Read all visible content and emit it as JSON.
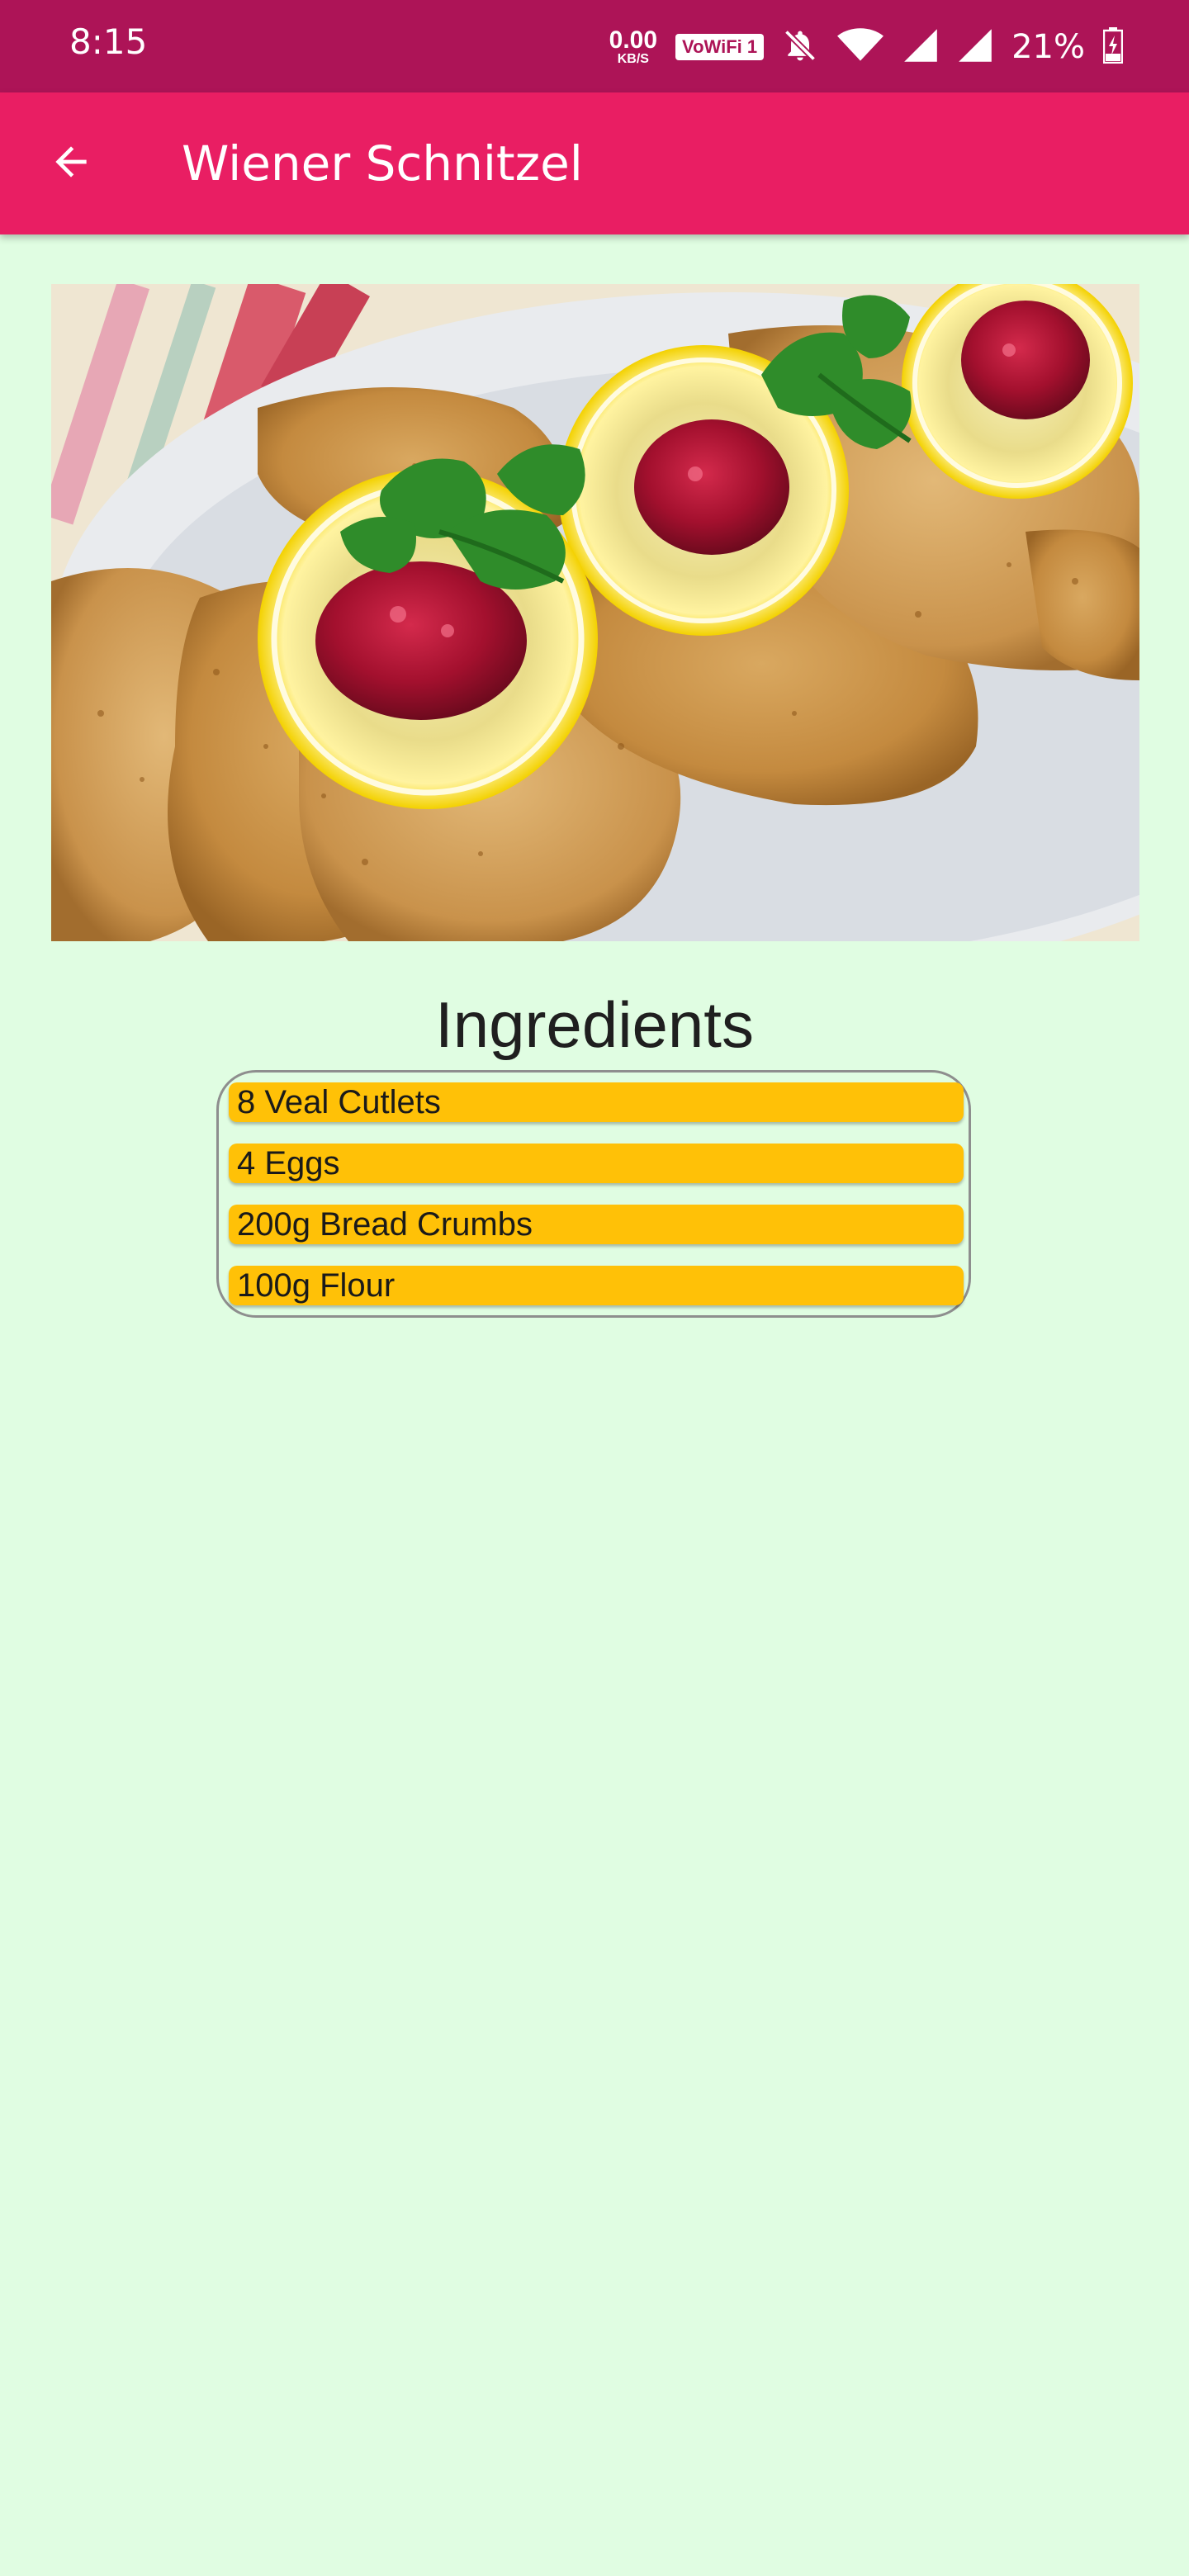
{
  "status_bar": {
    "time": "8:15",
    "net_speed_value": "0.00",
    "net_speed_unit": "KB/S",
    "vowifi_label": "VoWiFi 1",
    "battery_percent": "21%",
    "icons": [
      "bell-off-icon",
      "wifi-icon",
      "cell-signal-icon",
      "cell-signal-icon",
      "battery-charging-icon"
    ]
  },
  "app_bar": {
    "title": "Wiener Schnitzel",
    "back_icon": "arrow-left-icon"
  },
  "hero_image": {
    "subject": "wiener-schnitzel-photo"
  },
  "ingredients": {
    "title": "Ingredients",
    "items": [
      {
        "label": "8 Veal Cutlets"
      },
      {
        "label": "4 Eggs"
      },
      {
        "label": "200g Bread Crumbs"
      },
      {
        "label": "100g Flour"
      }
    ]
  },
  "colors": {
    "status_bar": "#ad1457",
    "app_bar": "#e91e63",
    "background": "#e0fde2",
    "ingredient_chip": "#ffc107"
  }
}
